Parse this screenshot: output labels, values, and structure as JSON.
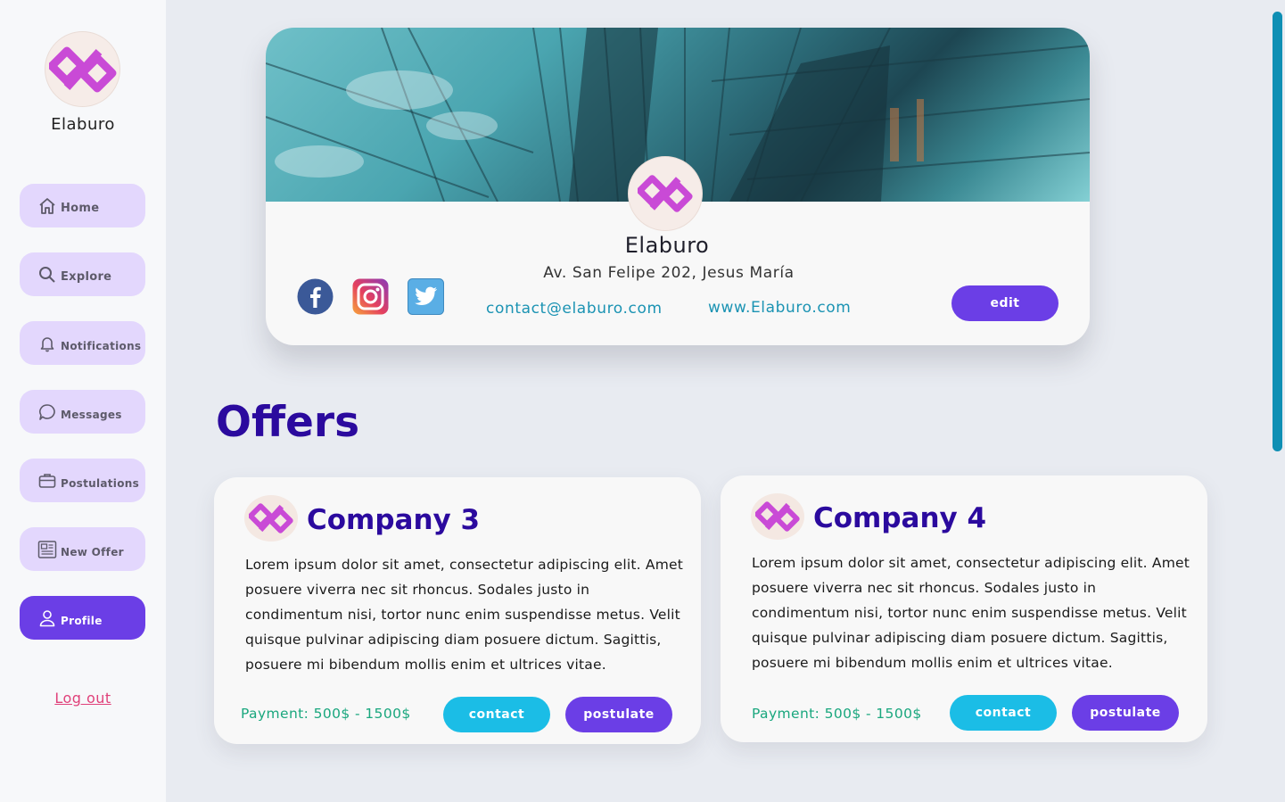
{
  "app": {
    "brand_name": "Elaburo",
    "brand_icon": "elaburo-logo",
    "accent_color": "#6b3ee6",
    "nav_bg": "#e3d7fd"
  },
  "sidebar": {
    "items": [
      {
        "label": "Home",
        "icon": "home-icon"
      },
      {
        "label": "Explore",
        "icon": "search-icon"
      },
      {
        "label": "Notifications",
        "icon": "bell-icon"
      },
      {
        "label": "Messages",
        "icon": "chat-bubble-icon"
      },
      {
        "label": "Postulations",
        "icon": "briefcase-icon"
      },
      {
        "label": "New Offer",
        "icon": "newspaper-icon"
      },
      {
        "label": "Profile",
        "icon": "user-icon",
        "active": true
      }
    ],
    "logout_label": "Log out"
  },
  "profile": {
    "name": "Elaburo",
    "address": "Av. San Felipe 202, Jesus María",
    "email": "contact@elaburo.com",
    "website": "www.Elaburo.com",
    "edit_label": "edit",
    "socials": [
      "facebook-icon",
      "instagram-icon",
      "twitter-icon"
    ]
  },
  "offers": {
    "title": "Offers",
    "items": [
      {
        "company": "Company 3",
        "description": "Lorem ipsum dolor sit amet, consectetur adipiscing elit. Amet posuere viverra nec sit rhoncus. Sodales justo in condimentum nisi, tortor nunc enim suspendisse metus. Velit quisque pulvinar adipiscing diam posuere dictum. Sagittis, posuere mi bibendum mollis enim et ultrices vitae.",
        "payment": "Payment: 500$ - 1500$",
        "contact_label": "contact",
        "postulate_label": "postulate"
      },
      {
        "company": "Company 4",
        "description": "Lorem ipsum dolor sit amet, consectetur adipiscing elit. Amet posuere viverra nec sit rhoncus. Sodales justo in condimentum nisi, tortor nunc enim suspendisse metus. Velit quisque pulvinar adipiscing diam posuere dictum. Sagittis, posuere mi bibendum mollis enim et ultrices vitae.",
        "payment": "Payment: 500$ - 1500$",
        "contact_label": "contact",
        "postulate_label": "postulate"
      }
    ]
  }
}
